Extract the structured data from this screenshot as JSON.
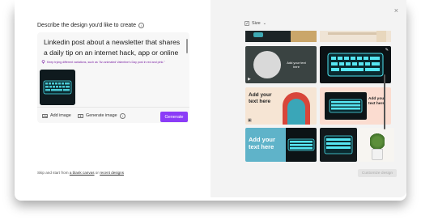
{
  "left_panel": {
    "heading": "Describe the design you'd like to create",
    "prompt_text": "Linkedin post about a newsletter that shares a daily tip on an internet hack, app or online",
    "hint": "Keep trying different variations, such as \"An animated Valentine's Day post in red and pink.\"",
    "add_image_label": "Add image",
    "generate_image_label": "Generate image",
    "generate_button": "Generate",
    "footer_prefix": "Skip and start from",
    "footer_link1": "a blank canvas",
    "footer_mid": "or",
    "footer_link2": "recent designs"
  },
  "right_panel": {
    "size_label": "Size",
    "close": "×",
    "customize_button": "Customize design",
    "tiles": [
      {
        "text": ""
      },
      {
        "text": "Add your text here"
      },
      {
        "text": ""
      },
      {
        "text": "Add your text here"
      },
      {
        "text": ""
      },
      {
        "text": "Add your text here"
      },
      {
        "text": "Add your text here"
      },
      {
        "text": ""
      },
      {
        "text": ""
      }
    ]
  },
  "colors": {
    "accent": "#8b3cf7",
    "teal": "#5fb3c9",
    "neon": "#4de3ef"
  }
}
